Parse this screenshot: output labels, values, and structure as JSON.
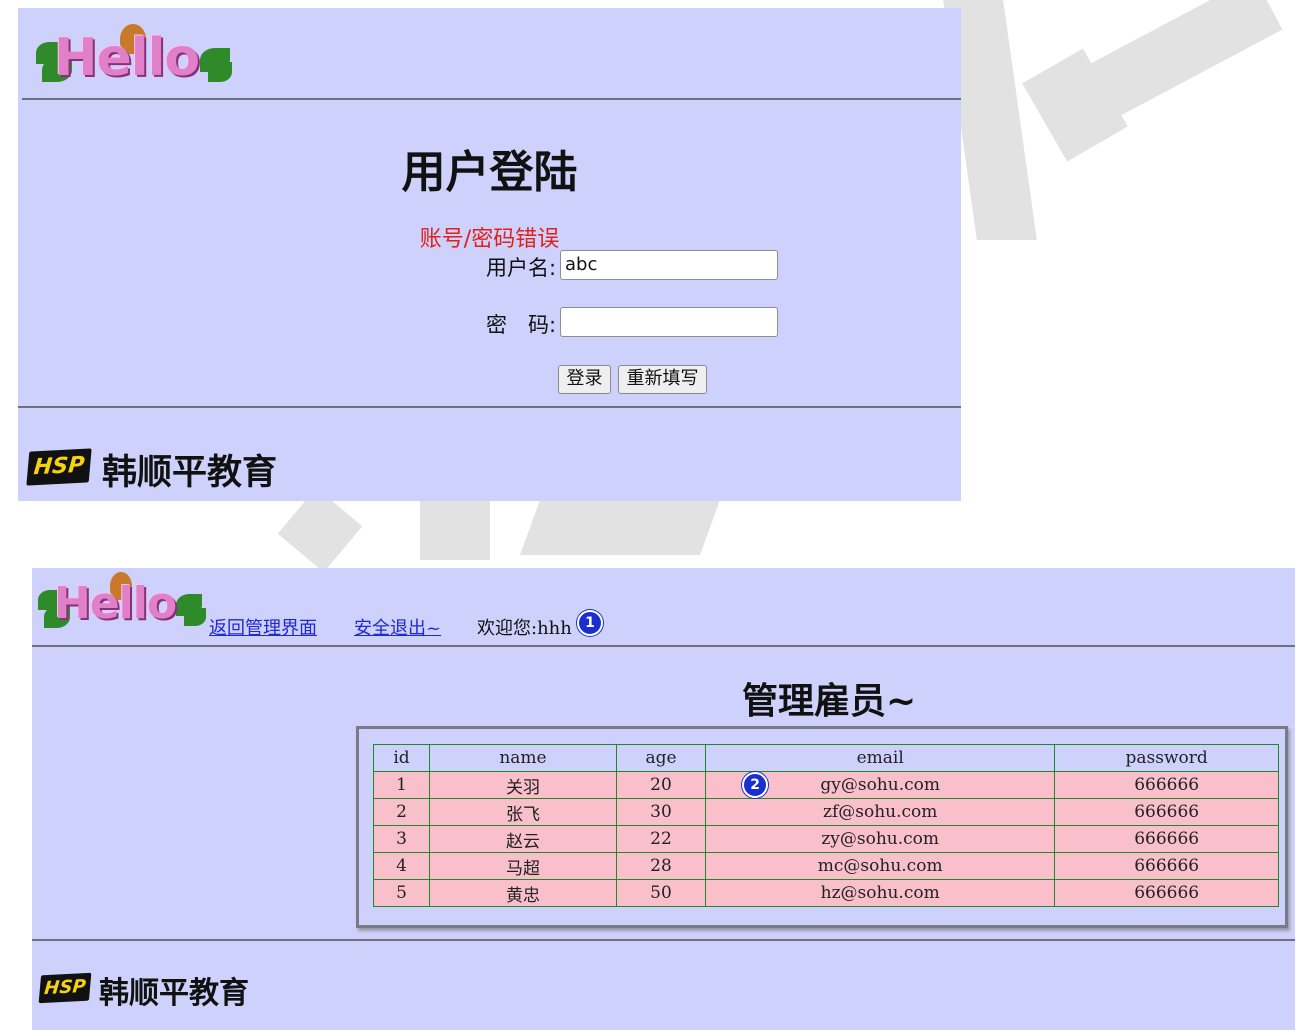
{
  "login": {
    "title": "用户登陆",
    "error": "账号/密码错误",
    "username_label": "用户名:",
    "username_value": "abc",
    "password_label": "密　码:",
    "password_value": "",
    "login_button": "登录",
    "reset_button": "重新填写",
    "logo_text": "Hello",
    "brand_badge": "HSP",
    "brand_name": "韩顺平教育"
  },
  "admin": {
    "logo_text": "Hello",
    "nav_back": "返回管理界面",
    "nav_logout": "安全退出~",
    "welcome": "欢迎您:hhh",
    "marker1": "1",
    "marker2": "2",
    "title": "管理雇员~",
    "table": {
      "headers": [
        "id",
        "name",
        "age",
        "email",
        "password"
      ],
      "rows": [
        [
          "1",
          "关羽",
          "20",
          "gy@sohu.com",
          "666666"
        ],
        [
          "2",
          "张飞",
          "30",
          "zf@sohu.com",
          "666666"
        ],
        [
          "3",
          "赵云",
          "22",
          "zy@sohu.com",
          "666666"
        ],
        [
          "4",
          "马超",
          "28",
          "mc@sohu.com",
          "666666"
        ],
        [
          "5",
          "黄忠",
          "50",
          "hz@sohu.com",
          "666666"
        ]
      ]
    },
    "brand_badge": "HSP",
    "brand_name": "韩顺平教育"
  },
  "colors": {
    "panel_bg": "#cdd1fb",
    "error_text": "#e0201a",
    "link": "#1f28d6",
    "row_bg": "#f9c0cc",
    "cell_border": "#208a2a",
    "marker_bg": "#1a2fcf"
  }
}
